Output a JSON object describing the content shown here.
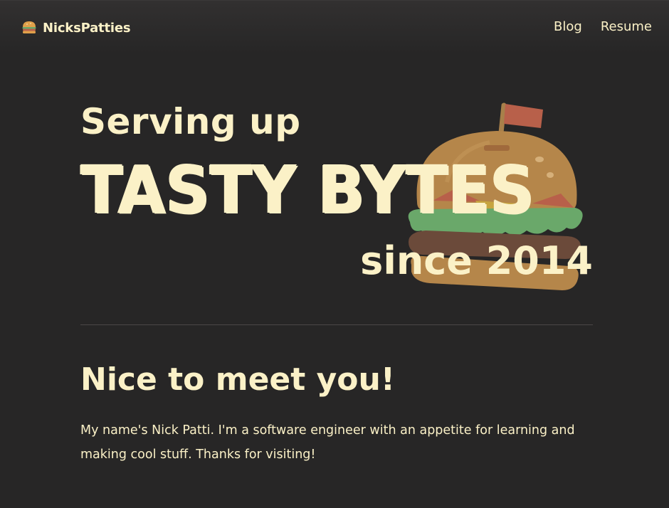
{
  "nav": {
    "brand": "NicksPatties",
    "brand_icon": "burger-icon",
    "links": [
      {
        "label": "Blog"
      },
      {
        "label": "Resume"
      }
    ]
  },
  "hero": {
    "line1": "Serving up",
    "line2": "TASTY BYTES",
    "line3": "since 2014",
    "illustration": "burger-illustration"
  },
  "intro": {
    "heading": "Nice to meet you!",
    "body": "My name's Nick Patti. I'm a software engineer with an appetite for learning and making cool stuff. Thanks for visiting!"
  },
  "colors": {
    "background": "#272626",
    "text": "#fbf1c7",
    "bun": "#b5864a",
    "lettuce": "#6aa86a",
    "patty": "#6b4a3a",
    "flag": "#b8604a"
  }
}
